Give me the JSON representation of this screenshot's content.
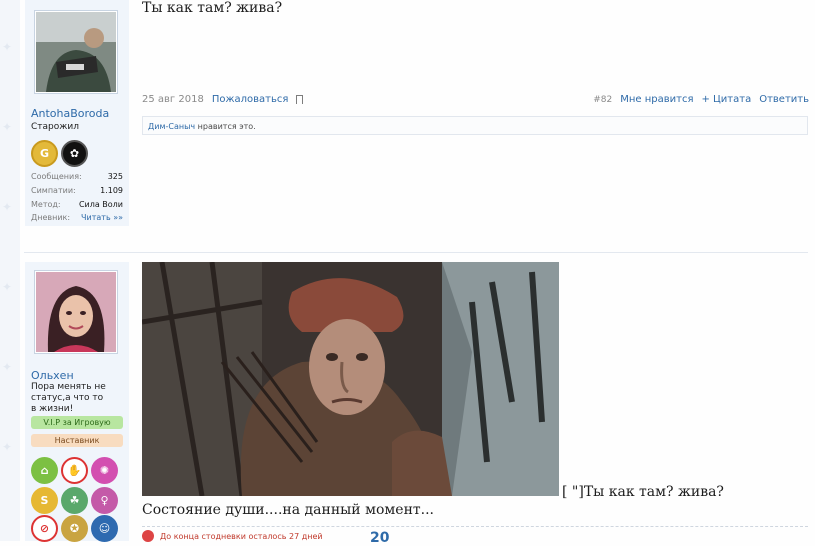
{
  "post1": {
    "message": "Ты как там? жива?",
    "date": "25 авг 2018",
    "report_label": "Пожаловаться",
    "post_number": "#82",
    "like_label": "Мне нравится",
    "quote_label": "+ Цитата",
    "reply_label": "Ответить",
    "likes_user": "Дим-Саныч",
    "likes_text": " нравится это.",
    "user": {
      "name": "AntohaBoroda",
      "title": "Старожил",
      "stats": [
        {
          "label": "Сообщения:",
          "value": "325"
        },
        {
          "label": "Симпатии:",
          "value": "1.109"
        },
        {
          "label": "Метод:",
          "value": "Сила Воли"
        },
        {
          "label": "Дневник:",
          "value": "Читать »»"
        }
      ]
    }
  },
  "post2": {
    "quote_fragment": "[ \"]Ты как там? жива?",
    "message": "Состояние души....на данный момент...",
    "signature_text": "До конца стодневки осталось 27 дней",
    "signature_number": "20",
    "user": {
      "name": "Ольхен",
      "title": "Пора менять не статус,а что то в жизни!",
      "vip_label": "V.I.P за Игровую",
      "mentor_label": "Наставник"
    }
  },
  "colors": {
    "link": "#2e6aa8",
    "panel_bg": "#f0f5fb",
    "vip_bg": "#b8e6a0",
    "mentor_bg": "#f8dcc0"
  }
}
